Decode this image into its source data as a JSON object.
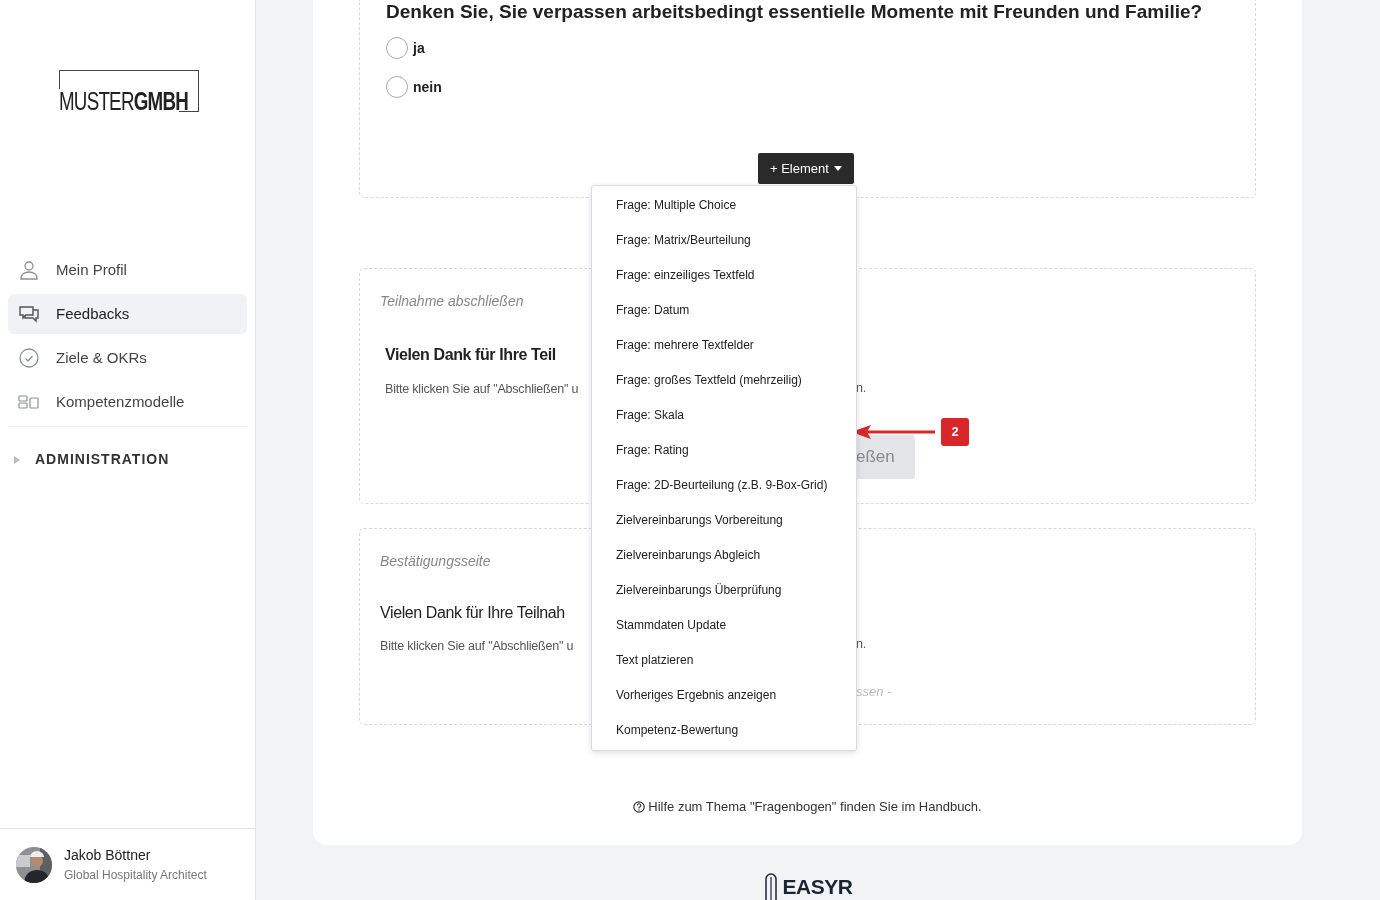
{
  "sidebar": {
    "logo": {
      "light": "MUSTER",
      "bold": "GMBH"
    },
    "nav": [
      {
        "kind": "person",
        "label": "Mein Profil",
        "selected": false
      },
      {
        "kind": "chat",
        "label": "Feedbacks",
        "selected": true
      },
      {
        "kind": "check",
        "label": "Ziele & OKRs",
        "selected": false
      },
      {
        "kind": "blocks",
        "label": "Kompetenzmodelle",
        "selected": false
      }
    ],
    "section": {
      "label": "ADMINISTRATION",
      "expanded": false
    },
    "user": {
      "name": "Jakob Böttner",
      "role": "Global Hospitality Architect"
    }
  },
  "question": {
    "title": "Denken Sie, Sie verpassen arbeitsbedingt essentielle Momente mit Freunden und Familie?",
    "options": [
      {
        "label": "ja",
        "selected": false
      },
      {
        "label": "nein",
        "selected": false
      }
    ]
  },
  "add_element": {
    "label": "+ Element",
    "menu": [
      "Frage: Multiple Choice",
      "Frage: Matrix/Beurteilung",
      "Frage: einzeiliges Textfeld",
      "Frage: Datum",
      "Frage: mehrere Textfelder",
      "Frage: großes Textfeld (mehrzeilig)",
      "Frage: Skala",
      "Frage: Rating",
      "Frage: 2D-Beurteilung (z.B. 9-Box-Grid)",
      "Zielvereinbarungs Vorbereitung",
      "Zielvereinbarungs Abgleich",
      "Zielvereinbarungs Überprüfung",
      "Stammdaten Update",
      "Text platzieren",
      "Vorheriges Ergebnis anzeigen",
      "Kompetenz-Bewertung"
    ]
  },
  "annotation": {
    "number": "2"
  },
  "cards": [
    {
      "kind": "finish",
      "label": "Teilnahme abschließen",
      "heading": "Vielen Dank für Ihre Teil",
      "text_left": "Bitte klicken Sie auf \"Abschließen\" u",
      "text_right": "n.",
      "button": "eßen"
    },
    {
      "kind": "confirmation",
      "label": "Bestätigungsseite",
      "heading": "Vielen Dank für Ihre Teilnah",
      "text_left": "Bitte klicken Sie auf \"Abschließen\" u",
      "text_right": "n.",
      "note": "ssen -"
    }
  ],
  "help": "Hilfe zum Thema \"Fragenbogen\" finden Sie im Handbuch.",
  "footer": {
    "brand": "EASYR"
  }
}
